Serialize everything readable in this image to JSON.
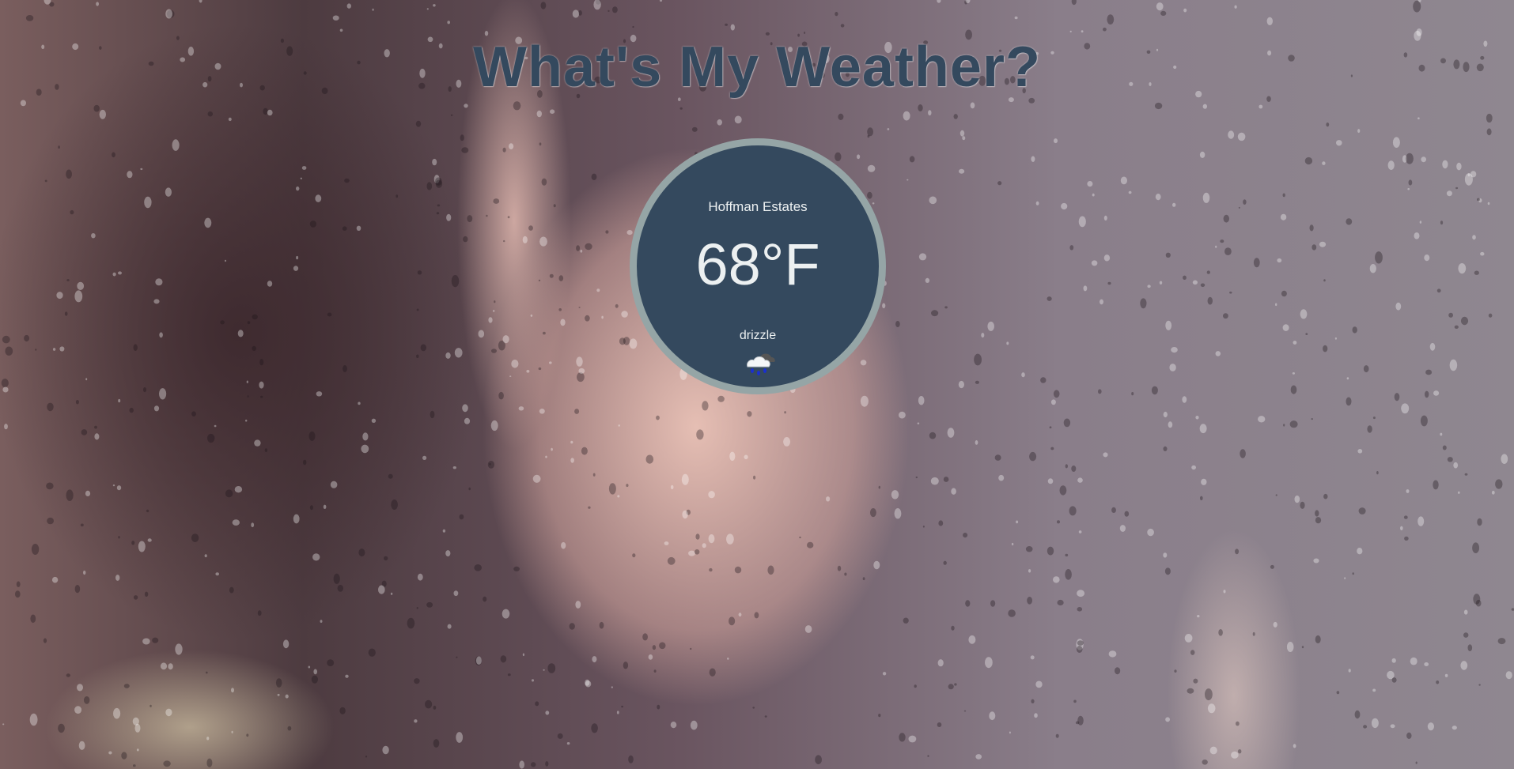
{
  "page": {
    "title": "What's My Weather?"
  },
  "weather": {
    "city": "Hoffman Estates",
    "temperature": "68°F",
    "description": "drizzle",
    "icon": "drizzle-cloud-icon"
  },
  "colors": {
    "title": "#34495e",
    "circle_fill": "#34495e",
    "circle_border": "#95a5a6",
    "text": "#ecf0f1"
  }
}
